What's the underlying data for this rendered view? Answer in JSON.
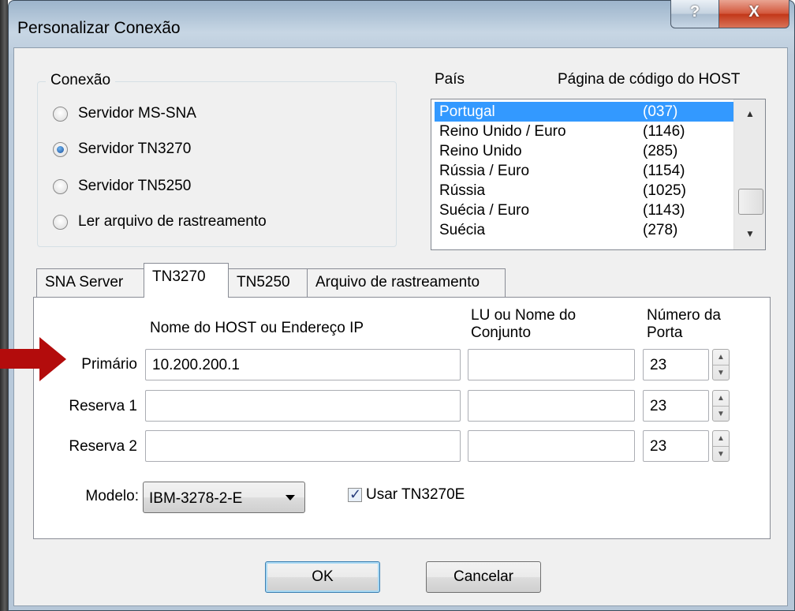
{
  "window": {
    "title": "Personalizar Conexão",
    "help_glyph": "?",
    "close_glyph": "X"
  },
  "conexao": {
    "label": "Conexão",
    "options": [
      {
        "label": "Servidor MS-SNA",
        "checked": false
      },
      {
        "label": "Servidor TN3270",
        "checked": true
      },
      {
        "label": "Servidor TN5250",
        "checked": false
      },
      {
        "label": "Ler arquivo de rastreamento",
        "checked": false
      }
    ]
  },
  "pais": {
    "label": "País",
    "codepage_label": "Página de código do HOST",
    "rows": [
      {
        "country": "Portugal",
        "code": "(037)",
        "selected": true
      },
      {
        "country": "Reino Unido / Euro",
        "code": "(1146)",
        "selected": false
      },
      {
        "country": "Reino Unido",
        "code": "(285)",
        "selected": false
      },
      {
        "country": "Rússia / Euro",
        "code": "(1154)",
        "selected": false
      },
      {
        "country": "Rússia",
        "code": "(1025)",
        "selected": false
      },
      {
        "country": "Suécia / Euro",
        "code": "(1143)",
        "selected": false
      },
      {
        "country": "Suécia",
        "code": "(278)",
        "selected": false
      }
    ]
  },
  "tabs": [
    {
      "label": "SNA Server",
      "active": false
    },
    {
      "label": "TN3270",
      "active": true
    },
    {
      "label": "TN5250",
      "active": false
    },
    {
      "label": "Arquivo de rastreamento",
      "active": false
    }
  ],
  "tn3270": {
    "header_host": "Nome do HOST ou Endereço IP",
    "header_lu_1": "LU ou Nome do",
    "header_lu_2": "Conjunto",
    "header_port_1": "Número da",
    "header_port_2": "Porta",
    "rows": [
      {
        "label": "Primário",
        "host": "10.200.200.1",
        "lu": "",
        "port": "23"
      },
      {
        "label": "Reserva 1",
        "host": "",
        "lu": "",
        "port": "23"
      },
      {
        "label": "Reserva 2",
        "host": "",
        "lu": "",
        "port": "23"
      }
    ],
    "model_label": "Modelo:",
    "model_value": "IBM-3278-2-E",
    "use_tn3270e_label": "Usar TN3270E",
    "use_tn3270e_checked": true
  },
  "buttons": {
    "ok": "OK",
    "cancel": "Cancelar"
  },
  "colors": {
    "selection": "#3399ff",
    "annotation_arrow": "#b30c0c",
    "close_button": "#c23617"
  }
}
